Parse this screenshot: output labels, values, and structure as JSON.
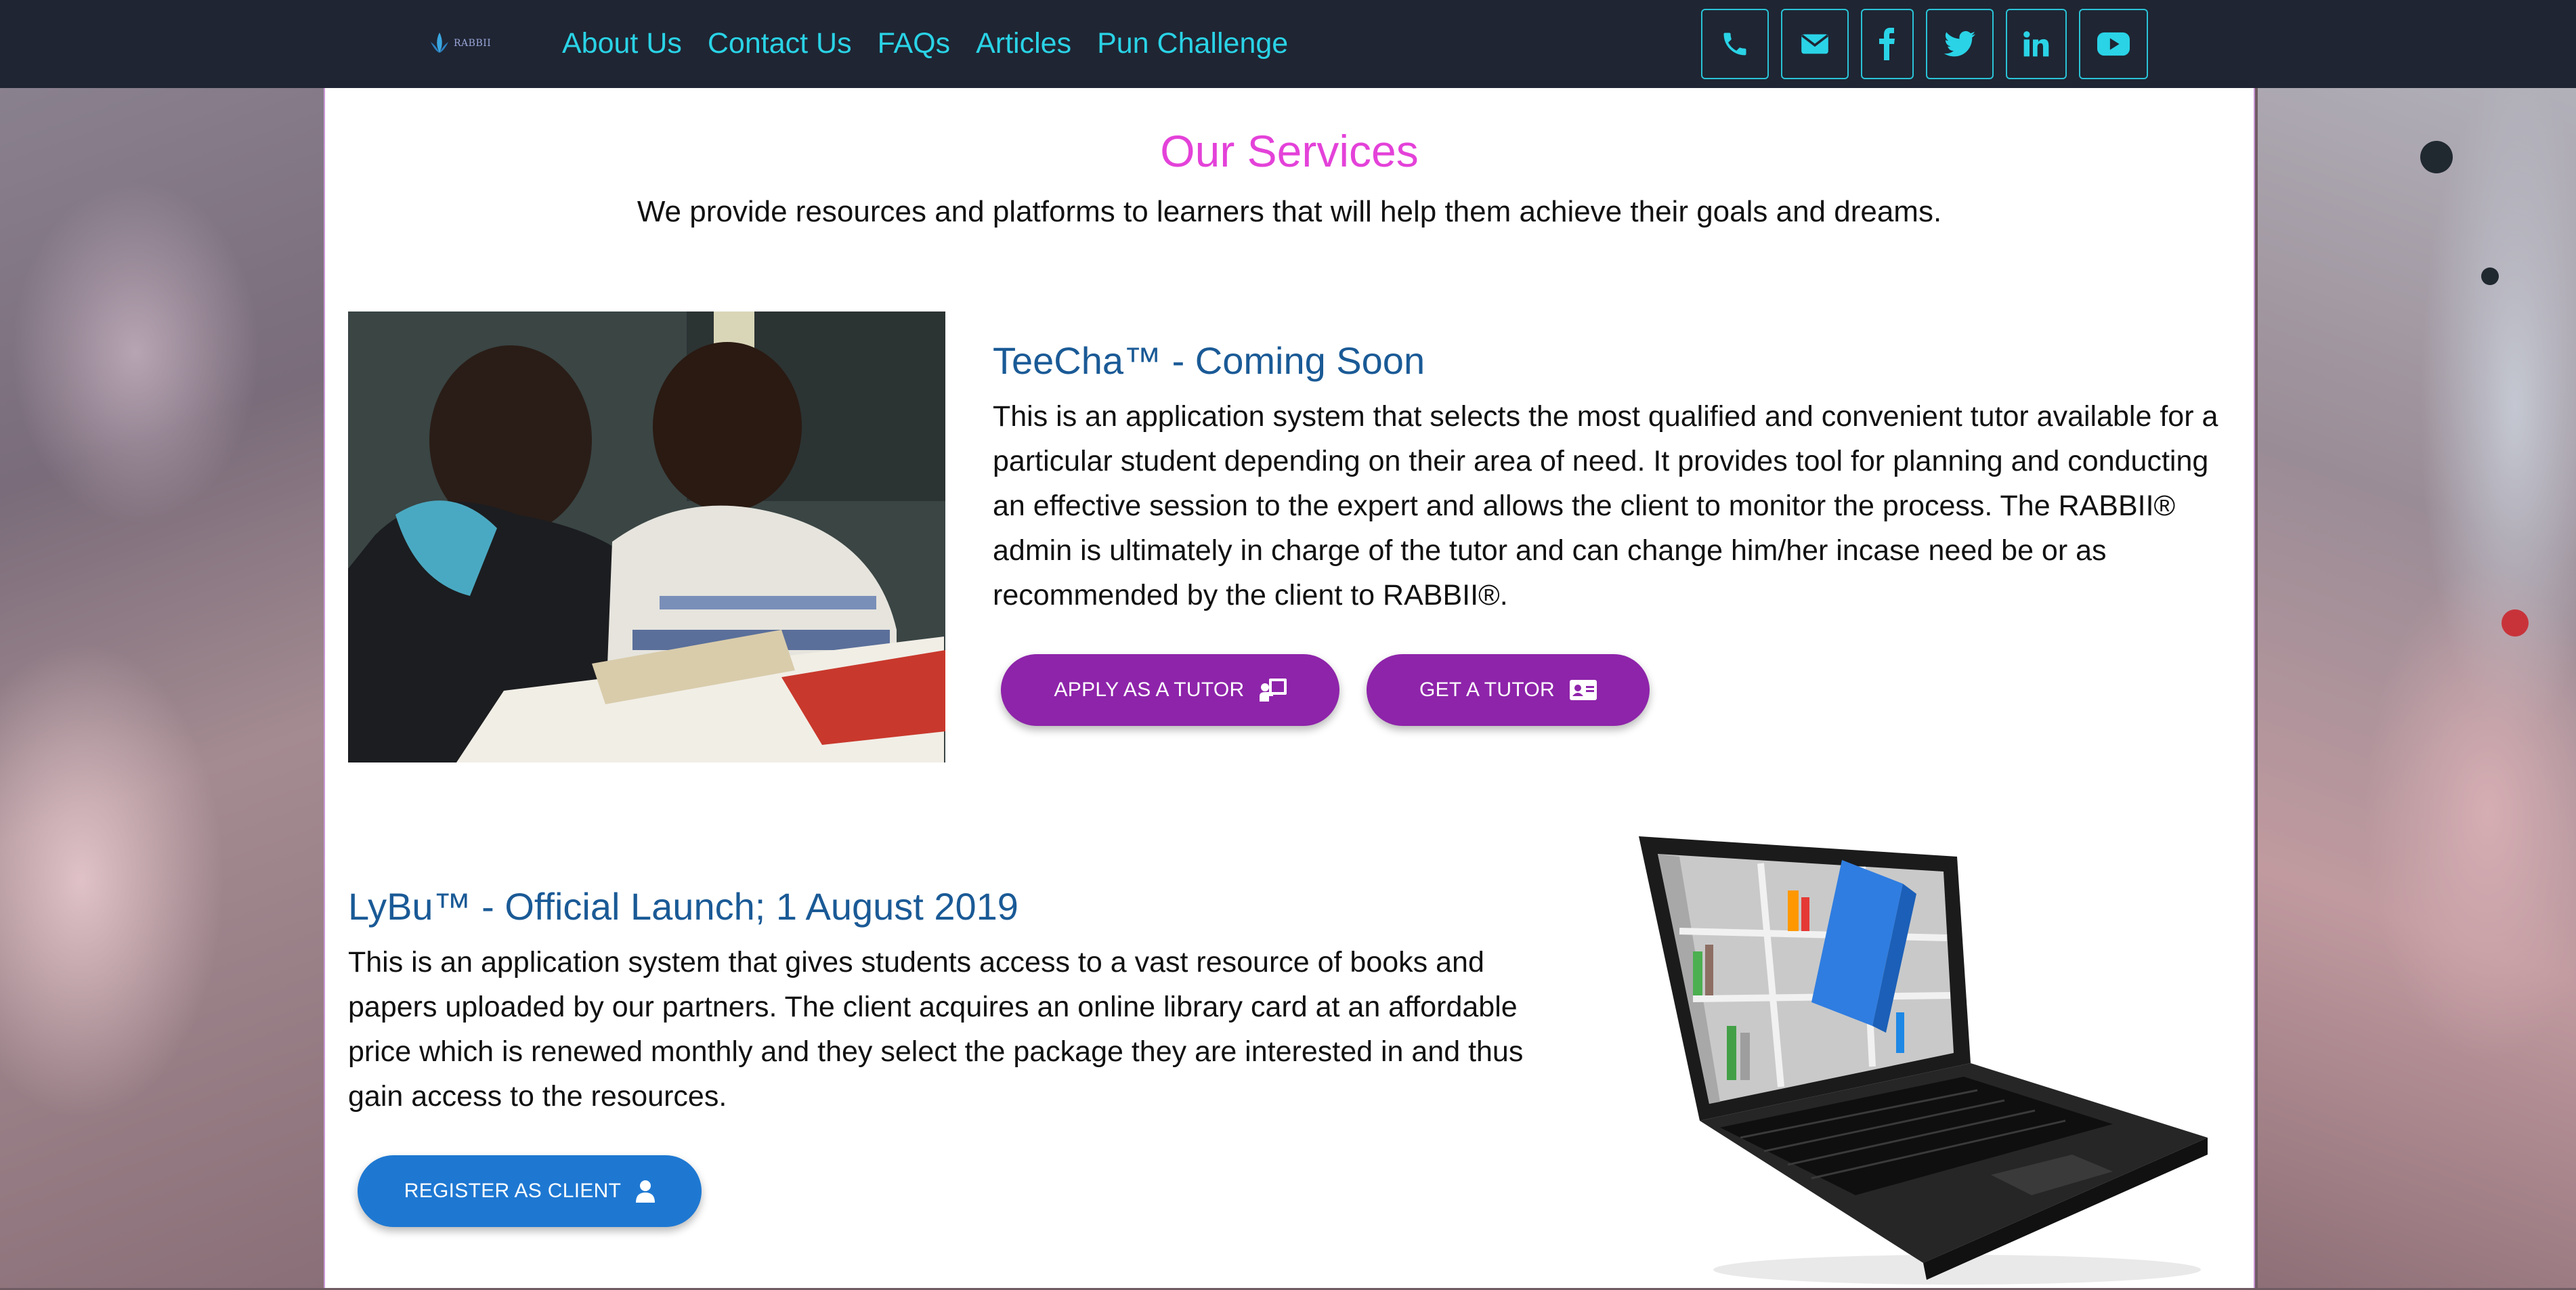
{
  "header": {
    "logo_text": "RABBII",
    "nav": [
      "About Us",
      "Contact Us",
      "FAQs",
      "Articles",
      "Pun Challenge"
    ],
    "social_icons": [
      "phone-icon",
      "envelope-icon",
      "facebook-icon",
      "twitter-icon",
      "linkedin-icon",
      "youtube-icon"
    ]
  },
  "main": {
    "title": "Our Services",
    "subtitle": "We provide resources and platforms to learners that will help them achieve their goals and dreams."
  },
  "services": [
    {
      "title": "TeeCha™ - Coming Soon",
      "description": "This is an application system that selects the most qualified and convenient tutor available for a particular student depending on their area of need. It provides tool for planning and conducting an effective session to the expert and allows the client to monitor the process. The RABBII® admin is ultimately in charge of the tutor and can change him/her incase need be or as recommended by the client to RABBII®.",
      "buttons": [
        {
          "label": "APPLY AS A TUTOR",
          "icon": "chalkboard-teacher-icon"
        },
        {
          "label": "GET A TUTOR",
          "icon": "id-card-icon"
        }
      ]
    },
    {
      "title": "LyBu™ - Official Launch; 1 August 2019",
      "description": "This is an application system that gives students access to a vast resource of books and papers uploaded by our partners. The client acquires an online library card at an affordable price which is renewed monthly and they select the package they are interested in and thus gain access to the resources.",
      "buttons": [
        {
          "label": "REGISTER AS CLIENT",
          "icon": "user-icon"
        }
      ]
    }
  ],
  "colors": {
    "header_bg": "#1f2533",
    "nav_link": "#2ad3e6",
    "title_pink": "#e442d9",
    "service_title": "#1a5a96",
    "button_purple": "#8e24aa",
    "button_blue": "#1e78d2"
  }
}
